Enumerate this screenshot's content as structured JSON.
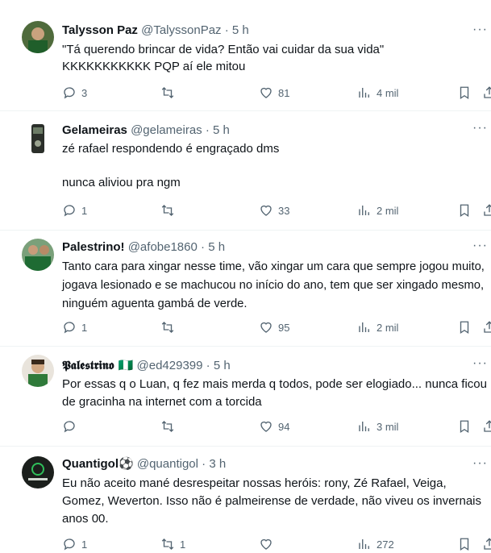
{
  "tweets": [
    {
      "name": "Talysson Paz",
      "handle": "@TalyssonPaz",
      "sep": "·",
      "time": "5 h",
      "text": "\"Tá querendo brincar de vida? Então vai cuidar da sua vida\"\nKKKKKKKKKKK PQP aí ele mitou",
      "replies": "3",
      "retweets": "",
      "likes": "81",
      "views": "4 mil",
      "more": "···"
    },
    {
      "name": "Gelameiras",
      "handle": "@gelameiras",
      "sep": "·",
      "time": "5 h",
      "text": "zé rafael respondendo é engraçado dms\n\nnunca aliviou pra ngm",
      "replies": "1",
      "retweets": "",
      "likes": "33",
      "views": "2 mil",
      "more": "···"
    },
    {
      "name": "Palestrino!",
      "handle": "@afobe1860",
      "sep": "·",
      "time": "5 h",
      "text": "Tanto cara para xingar nesse time, vão xingar um cara que sempre jogou muito, jogava lesionado e se machucou no início do ano, tem que ser xingado mesmo, ninguém aguenta gambá de verde.",
      "replies": "1",
      "retweets": "",
      "likes": "95",
      "views": "2 mil",
      "more": "···"
    },
    {
      "name": "𝕻𝖆𝖑𝖊𝖘𝖙𝖗𝖎𝖓𝖔 🇳🇬",
      "handle": "@ed429399",
      "sep": "·",
      "time": "5 h",
      "text": "Por essas q o Luan, q fez mais merda q todos, pode ser elogiado... nunca ficou de gracinha na internet com a torcida",
      "replies": "",
      "retweets": "",
      "likes": "94",
      "views": "3 mil",
      "more": "···"
    },
    {
      "name": "Quantigol⚽",
      "handle": "@quantigol",
      "sep": "·",
      "time": "3 h",
      "text": "Eu não aceito mané desrespeitar nossas heróis: rony, Zé Rafael, Veiga, Gomez, Weverton. Isso não é palmeirense de verdade, não viveu os invernais anos 00.",
      "replies": "1",
      "retweets": "1",
      "likes": "",
      "views": "272",
      "more": "···"
    }
  ],
  "colors": {
    "text": "#0f1419",
    "secondary": "#536471",
    "divider": "#eff3f4"
  }
}
